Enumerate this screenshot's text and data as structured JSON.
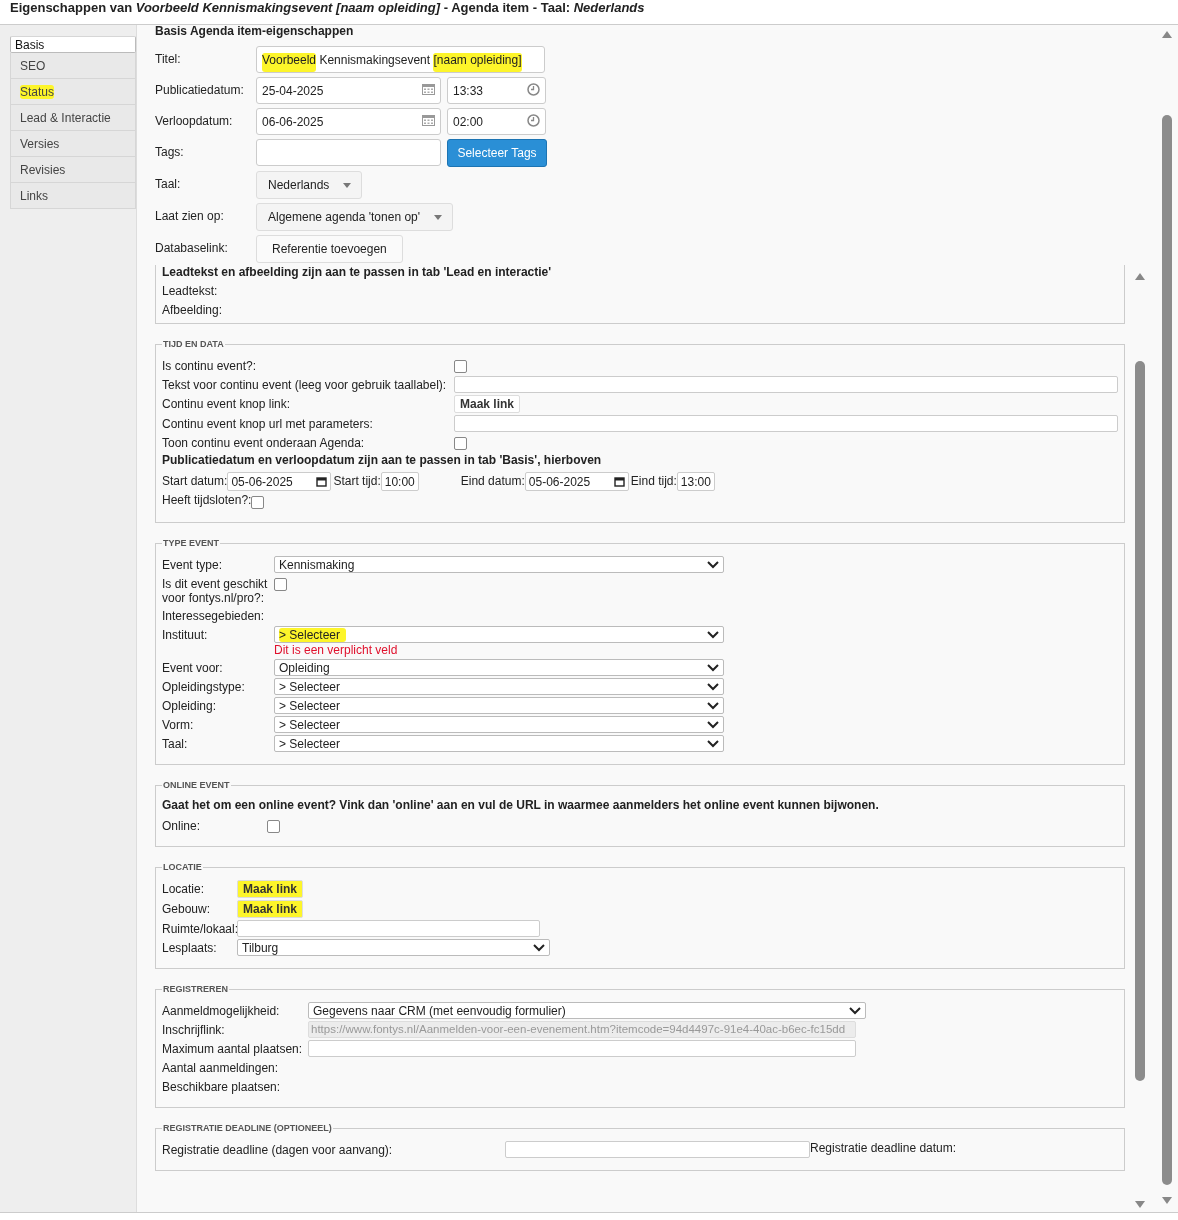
{
  "window": {
    "title": [
      {
        "text": "Eigenschappen van ",
        "italic": false
      },
      {
        "text": "Voorbeeld Kennismakingsevent [naam opleiding]",
        "italic": true
      },
      {
        "text": " - Agenda item - Taal: ",
        "italic": false
      },
      {
        "text": "Nederlands",
        "italic": true
      }
    ]
  },
  "sidebar": {
    "tabs": [
      {
        "label": "Basis",
        "selected": true,
        "highlighted": false
      },
      {
        "label": "SEO",
        "selected": false,
        "highlighted": false
      },
      {
        "label": "Status",
        "selected": false,
        "highlighted": true
      },
      {
        "label": "Lead & Interactie",
        "selected": false,
        "highlighted": false
      },
      {
        "label": "Versies",
        "selected": false,
        "highlighted": false
      },
      {
        "label": "Revisies",
        "selected": false,
        "highlighted": false
      },
      {
        "label": "Links",
        "selected": false,
        "highlighted": false
      }
    ]
  },
  "basis": {
    "heading": "Basis Agenda item-eigenschappen",
    "fields": [
      {
        "kind": "title",
        "label": "Titel:",
        "segments": [
          {
            "text": "Voorbeeld",
            "highlighted": true
          },
          {
            "text": " Kennismakingsevent ",
            "highlighted": false
          },
          {
            "text": "[naam opleiding]",
            "highlighted": true
          }
        ]
      },
      {
        "kind": "datetime",
        "label": "Publicatiedatum:",
        "date": "25-04-2025",
        "time": "13:33"
      },
      {
        "kind": "datetime",
        "label": "Verloopdatum:",
        "date": "06-06-2025",
        "time": "02:00"
      },
      {
        "kind": "tags",
        "label": "Tags:",
        "button": "Selecteer Tags"
      },
      {
        "kind": "dropdown",
        "label": "Taal:",
        "value": "Nederlands"
      },
      {
        "kind": "dropdown",
        "label": "Laat zien op:",
        "value": "Algemene agenda 'tonen op'"
      },
      {
        "kind": "button",
        "label": "Databaselink:",
        "button": "Referentie toevoegen"
      }
    ]
  },
  "lead": {
    "note": "Leadtekst en afbeelding zijn aan te passen in tab 'Lead en interactie'",
    "labels": [
      "Leadtekst:",
      "Afbeelding:"
    ]
  },
  "sections": [
    {
      "legend": "TIJD EN DATA",
      "rows": [
        {
          "kind": "checkbox",
          "label": "Is continu event?:",
          "checked": false
        },
        {
          "kind": "text",
          "label": "Tekst voor continu event (leeg voor gebruik taallabel):",
          "value": "",
          "disabled": false
        },
        {
          "kind": "link",
          "label": "Continu event knop link:",
          "button": "Maak link",
          "highlighted": false
        },
        {
          "kind": "text",
          "label": "Continu event knop url met parameters:",
          "value": "",
          "disabled": false
        },
        {
          "kind": "checkbox",
          "label": "Toon continu event onderaan Agenda:",
          "checked": false
        },
        {
          "kind": "note",
          "text": "Publicatiedatum en verloopdatum zijn aan te passen in tab 'Basis', hierboven"
        },
        {
          "kind": "inline",
          "items": [
            {
              "kind": "date",
              "label": "Start datum:",
              "value": "05-06-2025"
            },
            {
              "kind": "time",
              "label": "Start tijd:",
              "value": "10:00"
            },
            {
              "kind": "date",
              "label": "Eind datum:",
              "value": "05-06-2025"
            },
            {
              "kind": "time",
              "label": "Eind tijd:",
              "value": "13:00"
            }
          ]
        },
        {
          "kind": "inline_checkbox",
          "label": "Heeft tijdsloten?:",
          "checked": false
        }
      ]
    },
    {
      "legend": "TYPE EVENT",
      "rows": [
        {
          "kind": "select",
          "label": "Event type:",
          "value": "Kennismaking",
          "highlighted": false
        },
        {
          "kind": "checkbox",
          "label": "Is dit event geschikt voor fontys.nl/pro?:",
          "checked": false
        },
        {
          "kind": "label",
          "label": "Interessegebieden:"
        },
        {
          "kind": "select",
          "label": "Instituut:",
          "value": "> Selecteer",
          "highlighted": true,
          "error": "Dit is een verplicht veld"
        },
        {
          "kind": "select",
          "label": "Event voor:",
          "value": "Opleiding",
          "highlighted": false
        },
        {
          "kind": "select",
          "label": "Opleidingstype:",
          "value": "> Selecteer",
          "highlighted": false
        },
        {
          "kind": "select",
          "label": "Opleiding:",
          "value": "> Selecteer",
          "highlighted": false
        },
        {
          "kind": "select",
          "label": "Vorm:",
          "value": "> Selecteer",
          "highlighted": false
        },
        {
          "kind": "select",
          "label": "Taal:",
          "value": "> Selecteer",
          "highlighted": false
        }
      ]
    },
    {
      "legend": "ONLINE EVENT",
      "rows": [
        {
          "kind": "note",
          "text": "Gaat het om een online event? Vink dan 'online' aan en vul de URL in waarmee aanmelders het online event kunnen bijwonen."
        },
        {
          "kind": "checkbox",
          "label": "Online:",
          "checked": false
        }
      ]
    },
    {
      "legend": "LOCATIE",
      "rows": [
        {
          "kind": "link",
          "label": "Locatie:",
          "button": "Maak link",
          "highlighted": true
        },
        {
          "kind": "link",
          "label": "Gebouw:",
          "button": "Maak link",
          "highlighted": true
        },
        {
          "kind": "text",
          "label": "Ruimte/lokaal:",
          "value": "",
          "disabled": false
        },
        {
          "kind": "select",
          "label": "Lesplaats:",
          "value": "Tilburg",
          "highlighted": false
        }
      ]
    },
    {
      "legend": "REGISTREREN",
      "rows": [
        {
          "kind": "select",
          "label": "Aanmeldmogelijkheid:",
          "value": "Gegevens naar CRM (met eenvoudig formulier)",
          "highlighted": false
        },
        {
          "kind": "text",
          "label": "Inschrijflink:",
          "value": "https://www.fontys.nl/Aanmelden-voor-een-evenement.htm?itemcode=94d4497c-91e4-40ac-b6ec-fc15dd",
          "disabled": true
        },
        {
          "kind": "text",
          "label": "Maximum aantal plaatsen:",
          "value": "",
          "disabled": false
        },
        {
          "kind": "label",
          "label": "Aantal aanmeldingen:"
        },
        {
          "kind": "label",
          "label": "Beschikbare plaatsen:"
        }
      ]
    },
    {
      "legend": "REGISTRATIE DEADLINE (OPTIONEEL)",
      "rows": [
        {
          "kind": "text",
          "label": "Registratie deadline (dagen voor aanvang):",
          "value": "",
          "disabled": false,
          "after": "Registratie deadline datum:"
        }
      ]
    }
  ]
}
